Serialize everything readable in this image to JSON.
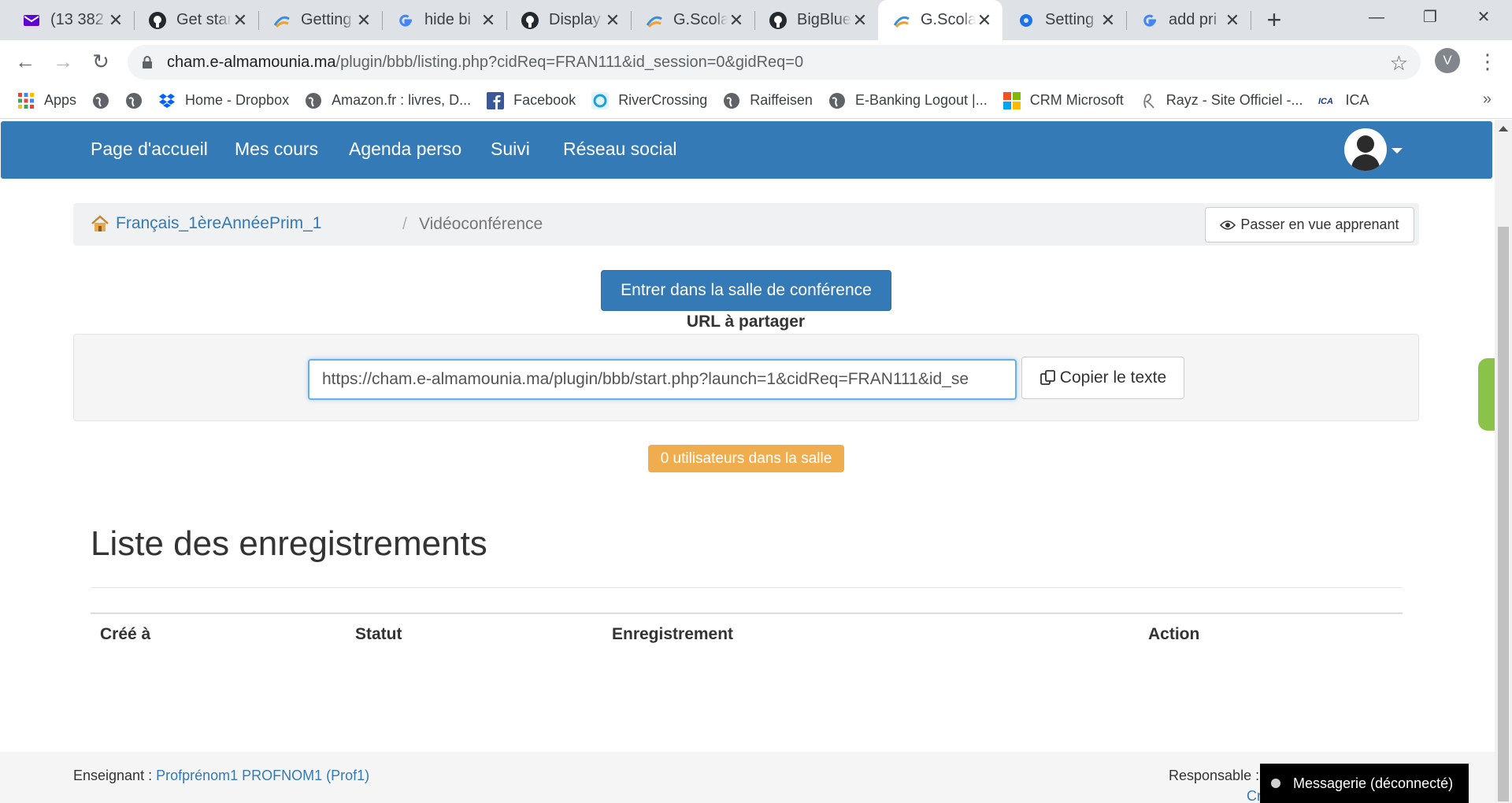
{
  "browser": {
    "tabs": [
      {
        "title": "(13 382",
        "icon": "yahoo-mail-icon",
        "active": false
      },
      {
        "title": "Get star",
        "icon": "github-icon",
        "active": false
      },
      {
        "title": "Getting",
        "icon": "gscolaire-icon",
        "active": false
      },
      {
        "title": "hide bi",
        "icon": "google-icon",
        "active": false
      },
      {
        "title": "Display",
        "icon": "github-icon",
        "active": false
      },
      {
        "title": "G.Scola",
        "icon": "gscolaire-icon",
        "active": false
      },
      {
        "title": "BigBlue",
        "icon": "github-icon",
        "active": false
      },
      {
        "title": "G.Scola",
        "icon": "gscolaire-icon",
        "active": true
      },
      {
        "title": "Setting",
        "icon": "settings-icon",
        "active": false
      },
      {
        "title": "add pri",
        "icon": "google-icon",
        "active": false
      }
    ],
    "new_tab_symbol": "+",
    "address": {
      "host": "cham.e-almamounia.ma",
      "path": "/plugin/bbb/listing.php?cidReq=FRAN111&id_session=0&gidReq=0"
    },
    "profile_initial": "V",
    "bookmarks": [
      {
        "label": "Apps",
        "icon": "apps-grid-icon"
      },
      {
        "label": "",
        "icon": "globe-icon"
      },
      {
        "label": "",
        "icon": "globe-icon"
      },
      {
        "label": "Home - Dropbox",
        "icon": "dropbox-icon"
      },
      {
        "label": "Amazon.fr : livres, D...",
        "icon": "globe-icon"
      },
      {
        "label": "Facebook",
        "icon": "facebook-icon"
      },
      {
        "label": "RiverCrossing",
        "icon": "rivercrossing-icon"
      },
      {
        "label": "Raiffeisen",
        "icon": "globe-icon"
      },
      {
        "label": "E-Banking Logout |...",
        "icon": "globe-icon"
      },
      {
        "label": "CRM Microsoft",
        "icon": "microsoft-icon"
      },
      {
        "label": "Rayz - Site Officiel -...",
        "icon": "rayz-icon"
      },
      {
        "label": "ICA",
        "icon": "ica-icon"
      }
    ],
    "bookmarks_more": "»"
  },
  "navbar": {
    "links": [
      "Page d'accueil",
      "Mes cours",
      "Agenda perso",
      "Suivi",
      "Réseau social"
    ]
  },
  "breadcrumb": {
    "course": "Français_1èreAnnéePrim_1",
    "separator": "/",
    "current": "Vidéoconférence"
  },
  "learner_view_button": "Passer en vue apprenant",
  "conference": {
    "enter_button": "Entrer dans la salle de conférence",
    "share_label": "URL à partager",
    "share_url": "https://cham.e-almamounia.ma/plugin/bbb/start.php?launch=1&cidReq=FRAN111&id_se",
    "copy_button": "Copier le texte",
    "users_badge": "0 utilisateurs dans la salle"
  },
  "recordings": {
    "title": "Liste des enregistrements",
    "columns": [
      "Créé à",
      "Statut",
      "Enregistrement",
      "Action"
    ]
  },
  "footer": {
    "teacher_label": "Enseignant :",
    "teacher_name": "Profprénom1 PROFNOM1 (Prof1)",
    "responsible_label": "Responsable :",
    "responsible_link": "Cr"
  },
  "chat": {
    "label": "Messagerie (déconnecté)"
  },
  "colors": {
    "primary": "#337ab7",
    "warning": "#f0ad4e",
    "chrome_tabstrip": "#dee1e6"
  }
}
